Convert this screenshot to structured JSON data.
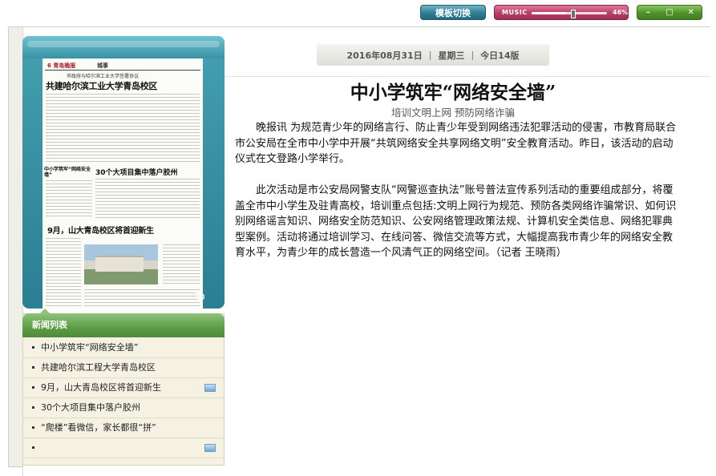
{
  "toolbar": {
    "template_switch": "模板切换",
    "music_label": "MUSIC",
    "music_volume_text": "46%",
    "music_volume_fraction": 0.46,
    "minimize_icon": "minimize-icon",
    "maximize_icon": "maximize-icon",
    "close_icon": "close-icon"
  },
  "datebar": {
    "date": "2016年08月31日",
    "weekday": "星期三",
    "edition": "今日14版"
  },
  "newspaper_thumb": {
    "page_num": "6",
    "masthead": "青岛晚报",
    "section": "城事",
    "kicker": "市政府与哈尔滨工业大学签署协议",
    "headline": "共建哈尔滨工业大学青岛校区",
    "story2_kicker": "中小学筑牢“网络安全墙”",
    "story2_headline": "30个大项目集中落户胶州",
    "story3_headline": "9月，山大青岛校区将首迎新生"
  },
  "news_list": {
    "title": "新闻列表",
    "items": [
      {
        "label": "中小学筑牢“网络安全墙”",
        "has_image": false
      },
      {
        "label": "共建哈尔滨工程大学青岛校区",
        "has_image": false
      },
      {
        "label": "9月，山大青岛校区将首迎新生",
        "has_image": true
      },
      {
        "label": "30个大项目集中落户胶州",
        "has_image": false
      },
      {
        "label": "“爬楼”看微信，家长都很“拼”",
        "has_image": false
      },
      {
        "label": "",
        "has_image": true
      }
    ]
  },
  "article": {
    "title": "中小学筑牢“网络安全墙”",
    "subtitle": "培训文明上网 预防网络诈骗",
    "paragraphs": [
      "晚报讯 为规范青少年的网络言行、防止青少年受到网络违法犯罪活动的侵害，市教育局联合市公安局在全市中小学中开展“共筑网络安全共享网络文明”安全教育活动。昨日，该活动的启动仪式在文登路小学举行。",
      "此次活动是市公安局网警支队“网警巡查执法”账号普法宣传系列活动的重要组成部分，将覆盖全市中小学生及驻青高校，培训重点包括:文明上网行为规范、预防各类网络诈骗常识、如何识别网络谣言知识、网络安全防范知识、公安网络管理政策法规、计算机安全类信息、网络犯罪典型案例。活动将通过培训学习、在线问答、微信交流等方式，大幅提高我市青少年的网络安全教育水平，为青少年的成长营造一个风清气正的网络空间。（记者 王晓雨）"
    ]
  }
}
